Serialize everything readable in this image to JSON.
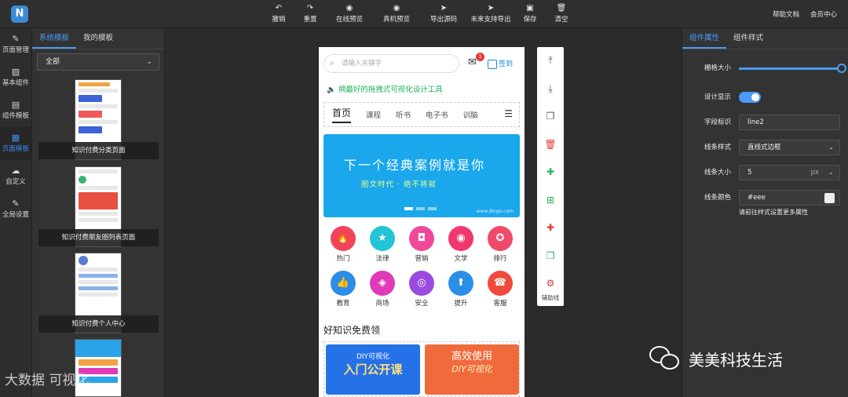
{
  "toolbar": {
    "logo": "N",
    "items": [
      {
        "icon": "undo-icon",
        "label": "撤销"
      },
      {
        "icon": "redo-icon",
        "label": "重置"
      },
      {
        "icon": "eye-icon",
        "label": "在线预览"
      },
      {
        "icon": "eye-icon",
        "label": "真机预览"
      },
      {
        "icon": "send-icon",
        "label": "导出源码"
      },
      {
        "icon": "send-icon",
        "label": "未来支持导出"
      },
      {
        "icon": "save-icon",
        "label": "保存"
      },
      {
        "icon": "trash-icon",
        "label": "清空"
      }
    ],
    "help": "帮助文档",
    "member": "会员中心"
  },
  "rail": [
    {
      "label": "页面管理",
      "icon": "pen-icon"
    },
    {
      "label": "基本组件",
      "icon": "image-icon"
    },
    {
      "label": "组件模板",
      "icon": "file-icon"
    },
    {
      "label": "页面模板",
      "icon": "page-icon",
      "active": true
    },
    {
      "label": "自定义",
      "icon": "cloud-icon"
    },
    {
      "label": "全局设置",
      "icon": "pen-icon"
    }
  ],
  "templates": {
    "tabs": [
      "系统模板",
      "我的模板"
    ],
    "filter": "全部",
    "items": [
      {
        "caption": "知识付费分类页面"
      },
      {
        "caption": "知识付费朋友圈列表页面"
      },
      {
        "caption": "知识付费个人中心"
      }
    ]
  },
  "phone": {
    "search_placeholder": "请输入关键字",
    "badge": "1",
    "signin": "签到",
    "notice": "拥最好的拖拽式可视化设计工具",
    "nav": [
      "首页",
      "课程",
      "听书",
      "电子书",
      "训脑"
    ],
    "banner": {
      "title": "下一个经典案例就是你",
      "subtitle": "图文时代 · 绝不将就",
      "url": "www.dingo.com"
    },
    "grid": [
      {
        "label": "热门",
        "color": "#f0445a",
        "icon": "flame-icon",
        "glyph": "🔥"
      },
      {
        "label": "法律",
        "color": "#22c4d6",
        "icon": "star-icon",
        "glyph": "★"
      },
      {
        "label": "营销",
        "color": "#f0489a",
        "icon": "bag-icon",
        "glyph": "◘"
      },
      {
        "label": "文学",
        "color": "#f0386e",
        "icon": "user-icon",
        "glyph": "◉"
      },
      {
        "label": "排行",
        "color": "#f04a6a",
        "icon": "medal-icon",
        "glyph": "✪"
      },
      {
        "label": "教育",
        "color": "#2b8de8",
        "icon": "thumb-icon",
        "glyph": "👍"
      },
      {
        "label": "商场",
        "color": "#e03ab8",
        "icon": "cart-icon",
        "glyph": "◈"
      },
      {
        "label": "安全",
        "color": "#9a4ae0",
        "icon": "lock-icon",
        "glyph": "◎"
      },
      {
        "label": "提升",
        "color": "#2a8fe6",
        "icon": "tray-icon",
        "glyph": "⬆"
      },
      {
        "label": "客服",
        "color": "#f04a3c",
        "icon": "chat-icon",
        "glyph": "☎"
      }
    ],
    "section_title": "好知识免费领",
    "card1": {
      "line1": "DIY可视化",
      "line2": "入门公开课"
    },
    "card2": {
      "line1": "高效使用",
      "line2": "DIY可视化"
    }
  },
  "floatbar": {
    "buttons": [
      {
        "icon": "move-up-icon",
        "glyph": "⤒",
        "color": "#555"
      },
      {
        "icon": "move-down-icon",
        "glyph": "⤓",
        "color": "#555"
      },
      {
        "icon": "copy-icon",
        "glyph": "❐",
        "color": "#555"
      },
      {
        "icon": "delete-icon",
        "glyph": "🗑",
        "color": "#e53935"
      },
      {
        "icon": "puzzle-icon",
        "glyph": "✚",
        "color": "#21b35a"
      },
      {
        "icon": "file-add-icon",
        "glyph": "⊞",
        "color": "#21b35a"
      },
      {
        "icon": "puzzle-icon",
        "glyph": "✚",
        "color": "#e53935"
      },
      {
        "icon": "copy-icon",
        "glyph": "❐",
        "color": "#21b35a"
      },
      {
        "icon": "settings-icon",
        "glyph": "⚙",
        "color": "#e53935"
      }
    ],
    "label": "辅助线"
  },
  "props": {
    "tabs": [
      "组件属性",
      "组件样式"
    ],
    "rows": [
      {
        "label": "栅格大小"
      },
      {
        "label": "设计显示"
      },
      {
        "label": "字段标识",
        "value": "line2"
      },
      {
        "label": "线条样式",
        "value": "直线式边框"
      },
      {
        "label": "线条大小",
        "value": "5",
        "unit": "px"
      },
      {
        "label": "线条颜色",
        "value": "#eee"
      }
    ],
    "hint": "请前往样式设置更多属性"
  },
  "watermark": {
    "left": "大数据 可视化",
    "right": "美美科技生活"
  }
}
